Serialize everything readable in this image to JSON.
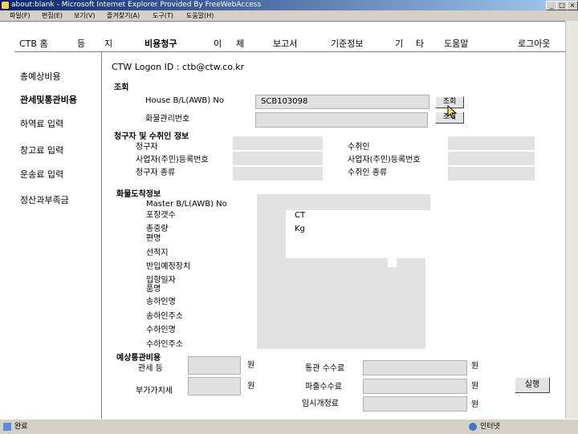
{
  "window": {
    "title": "about:blank - Microsoft Internet Explorer Provided By FreeWebAccess",
    "controls": [
      "_",
      "□",
      "×"
    ]
  },
  "menubar": [
    "파일(F)",
    "편집(E)",
    "보기(V)",
    "즐겨찾기(A)",
    "도구(T)",
    "도움말(H)"
  ],
  "topnav": [
    "CTB 홈",
    "등",
    "지",
    "비용청구",
    "이",
    "체",
    "보고서",
    "기준정보",
    "기",
    "타",
    "도움말",
    "로그아웃"
  ],
  "sidebar": [
    "총예상비용",
    "관세및통관비용",
    "하역료 입력",
    "창고료 입력",
    "운송료 입력",
    "정산과부족금"
  ],
  "logon": "CTW Logon ID : ctb@ctw.co.kr",
  "search": {
    "title": "조회",
    "house_label": "House B/L(AWB) No",
    "house_value": "SCB103098",
    "cargo_label": "화물관리번호",
    "cargo_value": "",
    "button": "조회"
  },
  "parties": {
    "title": "청구자 및 수취인 정보",
    "claimant": "청구자",
    "claimant_regno": "사업자(주민)등록번호",
    "claimant_type": "청구자 종류",
    "receiver": "수취인",
    "receiver_regno": "사업자(주민)등록번호",
    "receiver_type": "수취인 종류"
  },
  "arrival": {
    "title": "화물도착정보",
    "labels": [
      "Master B/L(AWB) No",
      "포장갯수",
      "총중량",
      "편명",
      "선적지",
      "반입예정장치",
      "입항일자",
      "품명",
      "송하인명",
      "송하인주소",
      "수하인명",
      "수하인주소"
    ],
    "unit_ct": "CT",
    "unit_kg": "Kg"
  },
  "costs": {
    "title": "예상통관비용",
    "customs_label": "관세 등",
    "vat_label": "부가가치세",
    "broker_label": "통관 수수료",
    "inspection_label": "파출수수료",
    "temp_label": "임시개청료",
    "currency": "원",
    "run_button": "실행"
  },
  "statusbar": {
    "left": "완료",
    "right": "인터넷"
  }
}
